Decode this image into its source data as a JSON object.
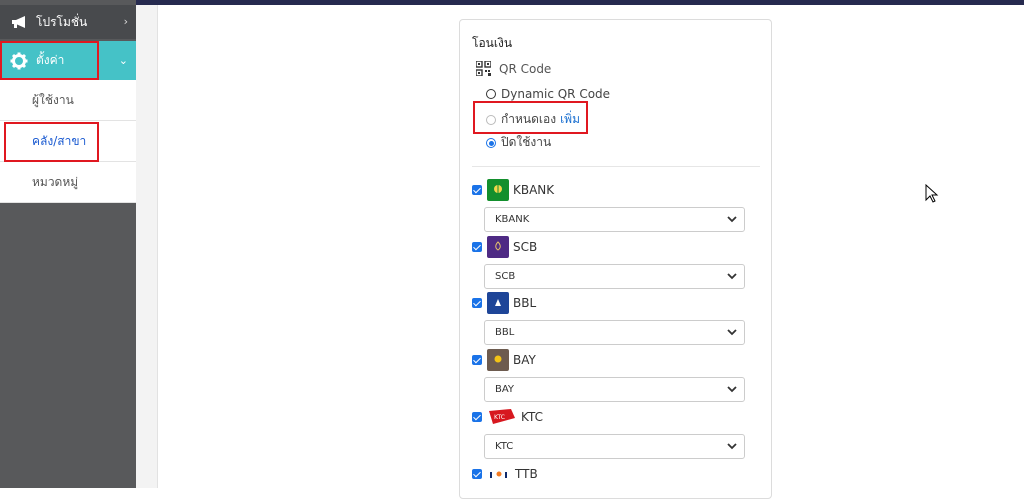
{
  "sidebar": {
    "promo_label": "โปรโมชั่น",
    "settings_label": "ตั้งค่า",
    "sub_items": [
      {
        "label": "ผู้ใช้งาน"
      },
      {
        "label": "คลัง/สาขา"
      },
      {
        "label": "หมวดหมู่"
      }
    ]
  },
  "payment": {
    "title": "โอนเงิน",
    "qr_label": "QR Code",
    "options": {
      "dynamic": "Dynamic QR Code",
      "custom": "กำหนดเอง",
      "custom_link": "เพิ่ม",
      "disabled": "ปิดใช้งาน"
    },
    "banks": [
      {
        "name": "KBANK",
        "selected": "KBANK",
        "color": "#138f2d"
      },
      {
        "name": "SCB",
        "selected": "SCB",
        "color": "#4e2a84"
      },
      {
        "name": "BBL",
        "selected": "BBL",
        "color": "#1e4598"
      },
      {
        "name": "BAY",
        "selected": "BAY",
        "color": "#6d5b4f"
      },
      {
        "name": "KTC",
        "selected": "KTC",
        "color": "#d7181f"
      },
      {
        "name": "TTB",
        "color": "#0e2a6b"
      }
    ]
  },
  "colors": {
    "accent": "#45c2c7",
    "highlight": "#e01820",
    "checkbox": "#1a73e8"
  }
}
